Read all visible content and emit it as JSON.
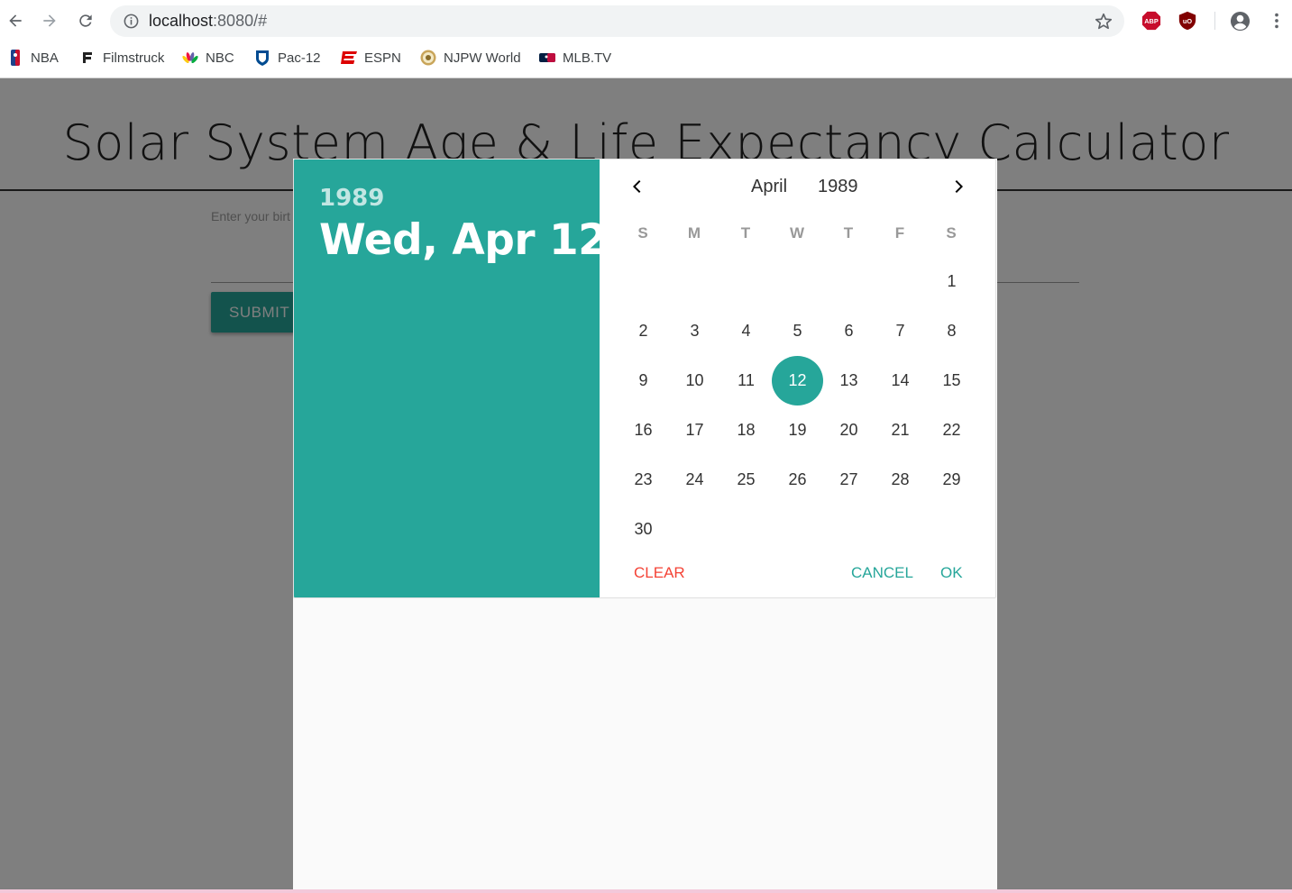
{
  "browser": {
    "url_host": "localhost",
    "url_rest": ":8080/#",
    "extensions": [
      "ABP",
      "uO"
    ],
    "bookmarks": [
      {
        "label": "NBA",
        "icon": "nba-icon"
      },
      {
        "label": "Filmstruck",
        "icon": "filmstruck-icon"
      },
      {
        "label": "NBC",
        "icon": "nbc-peacock-icon"
      },
      {
        "label": "Pac-12",
        "icon": "pac12-icon"
      },
      {
        "label": "ESPN",
        "icon": "espn-icon"
      },
      {
        "label": "NJPW World",
        "icon": "njpw-icon"
      },
      {
        "label": "MLB.TV",
        "icon": "mlb-icon"
      }
    ]
  },
  "app": {
    "title": "Solar System Age & Life Expectancy Calculator",
    "birth_label": "Enter your birt",
    "submit_label": "SUBMIT"
  },
  "datepicker": {
    "year": "1989",
    "selected_long": "Wed, Apr 12",
    "month": "April",
    "weekdays": [
      "S",
      "M",
      "T",
      "W",
      "T",
      "F",
      "S"
    ],
    "first_weekday_index": 6,
    "days_in_month": 30,
    "selected_day": 12,
    "clear_label": "CLEAR",
    "cancel_label": "CANCEL",
    "ok_label": "OK",
    "colors": {
      "accent": "#26a69a",
      "clear": "#f44336"
    }
  }
}
